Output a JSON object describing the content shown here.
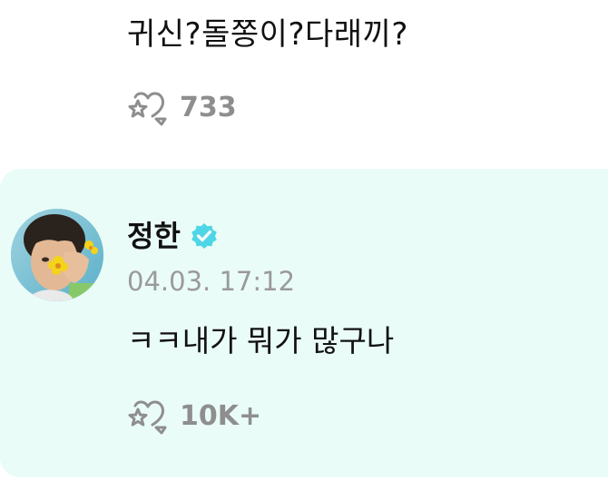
{
  "previous_comment": {
    "text": "귀신?돌쫑이?다래끼?",
    "reaction": {
      "icon": "reaction-heart-star-icon",
      "count": "733"
    }
  },
  "reply": {
    "author": {
      "name": "정한",
      "verified": true,
      "verified_icon": "verified-badge-icon",
      "avatar": "avatar"
    },
    "timestamp": "04.03. 17:12",
    "text": "ㅋㅋ내가 뭐가 많구나",
    "reaction": {
      "icon": "reaction-heart-star-icon",
      "count": "10K+"
    }
  },
  "colors": {
    "highlight_background": "#eafcf8",
    "verified_badge": "#4fd6e6",
    "muted_text": "#8e8e8e",
    "primary_text": "#111111"
  }
}
